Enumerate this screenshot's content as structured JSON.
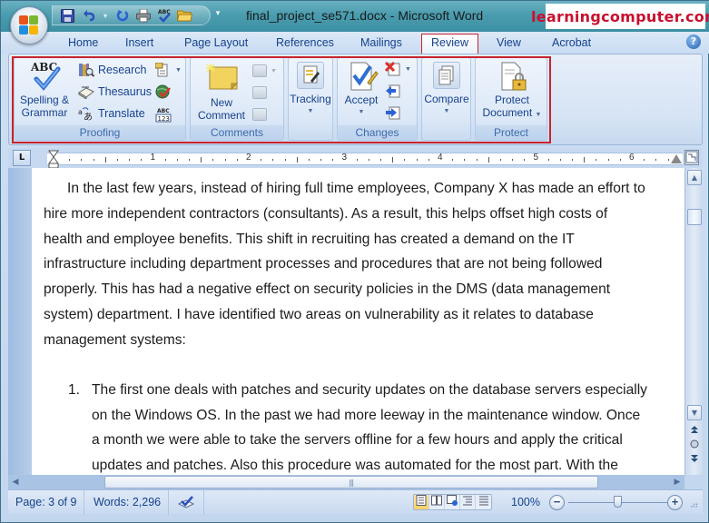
{
  "window": {
    "title": "final_project_se571.docx - Microsoft Word",
    "watermark": "learningcomputer.com"
  },
  "quick_access": {
    "items": [
      {
        "name": "save",
        "glyph": "💾"
      },
      {
        "name": "undo",
        "glyph": "↶"
      },
      {
        "name": "undo-dropdown",
        "glyph": "▾"
      },
      {
        "name": "redo",
        "glyph": "↻"
      },
      {
        "name": "print",
        "glyph": "🖶"
      },
      {
        "name": "spelling",
        "glyph": "✔"
      },
      {
        "name": "open",
        "glyph": "📂"
      }
    ],
    "more_glyph": "▾"
  },
  "tabs": [
    {
      "label": "Home",
      "active": false
    },
    {
      "label": "Insert",
      "active": false
    },
    {
      "label": "Page Layout",
      "active": false
    },
    {
      "label": "References",
      "active": false
    },
    {
      "label": "Mailings",
      "active": false
    },
    {
      "label": "Review",
      "active": true
    },
    {
      "label": "View",
      "active": false
    },
    {
      "label": "Acrobat",
      "active": false
    }
  ],
  "help_glyph": "?",
  "ribbon": {
    "proofing": {
      "label": "Proofing",
      "spelling_label_1": "Spelling &",
      "spelling_label_2": "Grammar",
      "spelling_icon_text": "ABC",
      "research": "Research",
      "thesaurus": "Thesaurus",
      "translate": "Translate",
      "word_count_icon_text_1": "ABC",
      "word_count_icon_text_2": "123"
    },
    "comments": {
      "label": "Comments",
      "new_comment_1": "New",
      "new_comment_2": "Comment"
    },
    "tracking": {
      "label": "Tracking"
    },
    "changes": {
      "label": "Changes",
      "accept": "Accept"
    },
    "compare": {
      "label": "Compare"
    },
    "protect": {
      "label": "Protect",
      "protect_1": "Protect",
      "protect_2": "Document"
    }
  },
  "ruler": {
    "tab_selector": "L",
    "numbers": [
      "1",
      "2",
      "3",
      "4",
      "5",
      "6"
    ]
  },
  "document": {
    "paragraph_lines": [
      "In the last few years, instead of hiring full time employees, Company X has made an effort to",
      "hire more independent contractors (consultants). As a result, this helps offset high costs of",
      "health and employee benefits. This shift in recruiting has created a demand on the IT",
      "infrastructure including department processes and procedures that are not being followed",
      "properly. This has had a negative effect on security policies in the DMS (data management",
      "system) department. I have identified two areas on vulnerability as it relates to database",
      "management systems:"
    ],
    "list_item": {
      "number": "1.",
      "lines": [
        "The first one deals with patches and security updates on the database servers especially",
        "on the Windows OS. In the past we had more leeway in the maintenance window. Once",
        "a month we were able to take the servers offline for a few hours and apply the critical",
        "updates and patches. Also this procedure was automated for the most part. With the"
      ]
    }
  },
  "scrollbar": {
    "up": "▲",
    "down": "▼",
    "prev_page": "⯭",
    "browse_object": "●",
    "next_page": "⯯",
    "left": "◀",
    "right": "▶",
    "grip": "|||"
  },
  "statusbar": {
    "page": "Page: 3 of 9",
    "words": "Words: 2,296",
    "zoom": "100%",
    "zoom_level_percent": 100,
    "zoom_out": "−",
    "zoom_in": "+",
    "view_buttons": [
      {
        "name": "print-layout",
        "glyph": "▤",
        "active": true
      },
      {
        "name": "full-screen-reading",
        "glyph": "📖",
        "active": false
      },
      {
        "name": "web-layout",
        "glyph": "🗔",
        "active": false
      },
      {
        "name": "outline",
        "glyph": "☰",
        "active": false
      },
      {
        "name": "draft",
        "glyph": "≡",
        "active": false
      }
    ]
  }
}
